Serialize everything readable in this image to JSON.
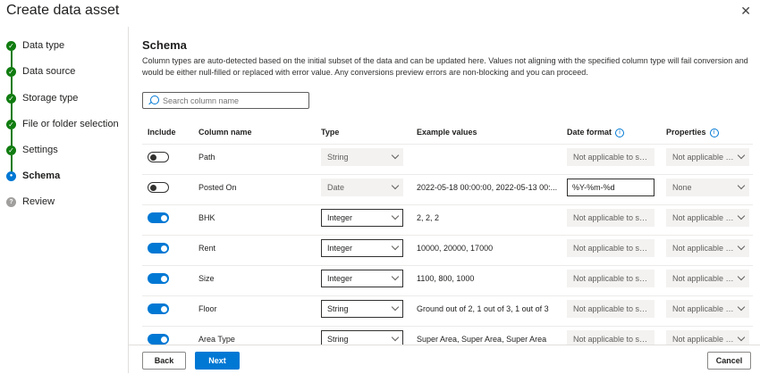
{
  "window": {
    "title": "Create data asset",
    "close_icon": "close-icon"
  },
  "steps": [
    {
      "label": "Data type",
      "status": "done"
    },
    {
      "label": "Data source",
      "status": "done"
    },
    {
      "label": "Storage type",
      "status": "done"
    },
    {
      "label": "File or folder selection",
      "status": "done"
    },
    {
      "label": "Settings",
      "status": "done"
    },
    {
      "label": "Schema",
      "status": "current"
    },
    {
      "label": "Review",
      "status": "todo"
    }
  ],
  "schema": {
    "title": "Schema",
    "description": "Column types are auto-detected based on the initial subset of the data and can be updated here. Values not aligning with the specified column type will fail conversion and would be either null-filled or replaced with error value. Any conversions preview errors are non-blocking and you can proceed.",
    "search_placeholder": "Search column name",
    "headers": {
      "include": "Include",
      "column_name": "Column name",
      "type": "Type",
      "example_values": "Example values",
      "date_format": "Date format",
      "properties": "Properties"
    },
    "rows": [
      {
        "include": false,
        "name": "Path",
        "type": "String",
        "type_enabled": false,
        "example": "",
        "date_format": "Not applicable to sel...",
        "date_editable": false,
        "properties": "Not applicable to ..."
      },
      {
        "include": false,
        "name": "Posted On",
        "type": "Date",
        "type_enabled": false,
        "example": "2022-05-18 00:00:00, 2022-05-13 00:...",
        "date_format": "%Y-%m-%d",
        "date_editable": true,
        "properties": "None"
      },
      {
        "include": true,
        "name": "BHK",
        "type": "Integer",
        "type_enabled": true,
        "example": "2, 2, 2",
        "date_format": "Not applicable to sel...",
        "date_editable": false,
        "properties": "Not applicable to ..."
      },
      {
        "include": true,
        "name": "Rent",
        "type": "Integer",
        "type_enabled": true,
        "example": "10000, 20000, 17000",
        "date_format": "Not applicable to sel...",
        "date_editable": false,
        "properties": "Not applicable to ..."
      },
      {
        "include": true,
        "name": "Size",
        "type": "Integer",
        "type_enabled": true,
        "example": "1100, 800, 1000",
        "date_format": "Not applicable to sel...",
        "date_editable": false,
        "properties": "Not applicable to ..."
      },
      {
        "include": true,
        "name": "Floor",
        "type": "String",
        "type_enabled": true,
        "example": "Ground out of 2, 1 out of 3, 1 out of 3",
        "date_format": "Not applicable to sel...",
        "date_editable": false,
        "properties": "Not applicable to ..."
      },
      {
        "include": true,
        "name": "Area Type",
        "type": "String",
        "type_enabled": true,
        "example": "Super Area, Super Area, Super Area",
        "date_format": "Not applicable to sel...",
        "date_editable": false,
        "properties": "Not applicable to ..."
      }
    ]
  },
  "footer": {
    "back": "Back",
    "next": "Next",
    "cancel": "Cancel"
  },
  "colors": {
    "accent": "#0078d4",
    "success": "#107c10",
    "todo": "#a19f9d"
  }
}
